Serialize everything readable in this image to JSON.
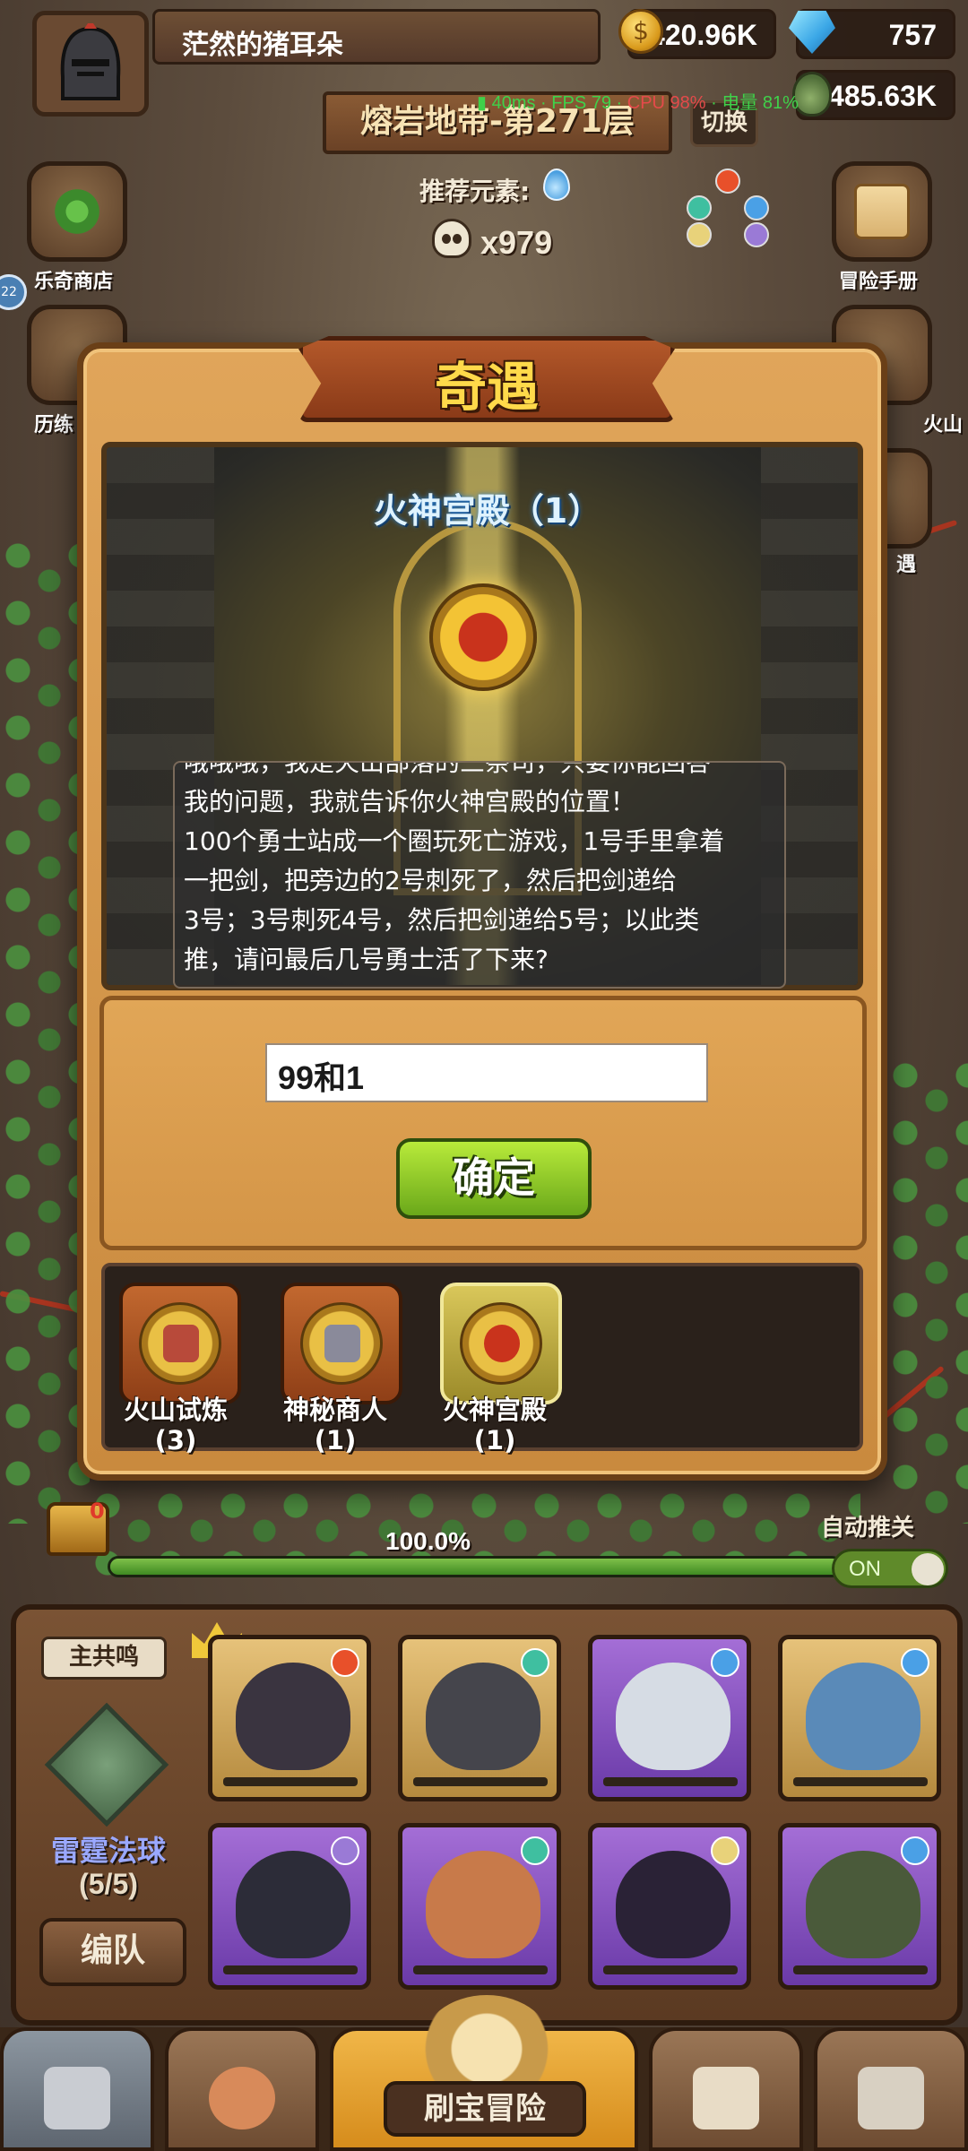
{
  "player": {
    "name": "茫然的猪耳朵"
  },
  "resources": {
    "gold": "420.96K",
    "gems": "757",
    "potion": "485.63K"
  },
  "stage": {
    "title": "熔岩地带-第271层",
    "switch_label": "切换"
  },
  "perf_overlay": {
    "ping": "40ms",
    "fps": "FPS 79",
    "cpu": "CPU 98%",
    "battery": "电量 81%"
  },
  "recommended": {
    "label": "推荐元素:",
    "element_icon": "water-drop-icon"
  },
  "kills": {
    "count": "x979"
  },
  "side_menu": {
    "left": [
      {
        "label": "乐奇商店",
        "icon": "clover-icon"
      },
      {
        "label": "历练",
        "icon": "vase-icon"
      }
    ],
    "right": [
      {
        "label": "冒险手册",
        "icon": "scroll-icon"
      },
      {
        "label": "火山",
        "icon": "volcano-icon"
      },
      {
        "label": "遇",
        "icon": "quest-icon"
      }
    ],
    "edge_badge": "22"
  },
  "modal": {
    "title": "奇遇",
    "scene_title": "火神宫殿（1）",
    "question": "哦哦哦，我是火山部落的三祭司，只要你能回答我的问题，我就告诉你火神宫殿的位置！\n100个勇士站成一个圈玩死亡游戏，1号手里拿着一把剑，把旁边的2号刺死了，然后把剑递给3号；3号刺死4号，然后把剑递给5号；以此类推，请问最后几号勇士活了下来?",
    "question_lines": [
      "哦哦哦，我是火山部落的三祭司，只要你能回答",
      "我的问题，我就告诉你火神宫殿的位置！",
      "100个勇士站成一个圈玩死亡游戏，1号手里拿着",
      "一把剑，把旁边的2号刺死了，然后把剑递给",
      "3号；3号刺死4号，然后把剑递给5号；以此类",
      "推，请问最后几号勇士活了下来?"
    ],
    "answer_value": "99和1",
    "confirm_label": "确定",
    "encounters": [
      {
        "name": "火山试炼",
        "count": "(3)",
        "icon": "book-medal-icon",
        "selected": false
      },
      {
        "name": "神秘商人",
        "count": "(1)",
        "icon": "merchant-medal-icon",
        "selected": false
      },
      {
        "name": "火神宫殿",
        "count": "(1)",
        "icon": "demon-medal-icon",
        "selected": true
      }
    ]
  },
  "progress": {
    "chest_count": "0",
    "percent_text": "100.0%",
    "fraction": 1.0,
    "auto_label": "自动推关",
    "toggle_text": "ON"
  },
  "team": {
    "leader_label": "主共鸣",
    "spell_name": "雷霆法球",
    "spell_count": "(5/5)",
    "formation_label": "编队",
    "heroes": [
      {
        "element": "fire",
        "rarity": "gold"
      },
      {
        "element": "wind",
        "rarity": "gold"
      },
      {
        "element": "water",
        "rarity": "purple"
      },
      {
        "element": "water",
        "rarity": "gold"
      },
      {
        "element": "moon",
        "rarity": "purple"
      },
      {
        "element": "wind",
        "rarity": "purple"
      },
      {
        "element": "light",
        "rarity": "purple"
      },
      {
        "element": "water",
        "rarity": "purple"
      }
    ]
  },
  "nav": {
    "center_label": "刷宝冒险",
    "tabs": [
      "shop-icon",
      "hero-icon",
      "treasure-map-icon",
      "backpack-icon",
      "forge-icon"
    ]
  },
  "colors": {
    "fire": "#e8502a",
    "wind": "#3fbfa0",
    "water": "#4aa0e6",
    "moon": "#9a7ad6",
    "light": "#e8d27a"
  }
}
